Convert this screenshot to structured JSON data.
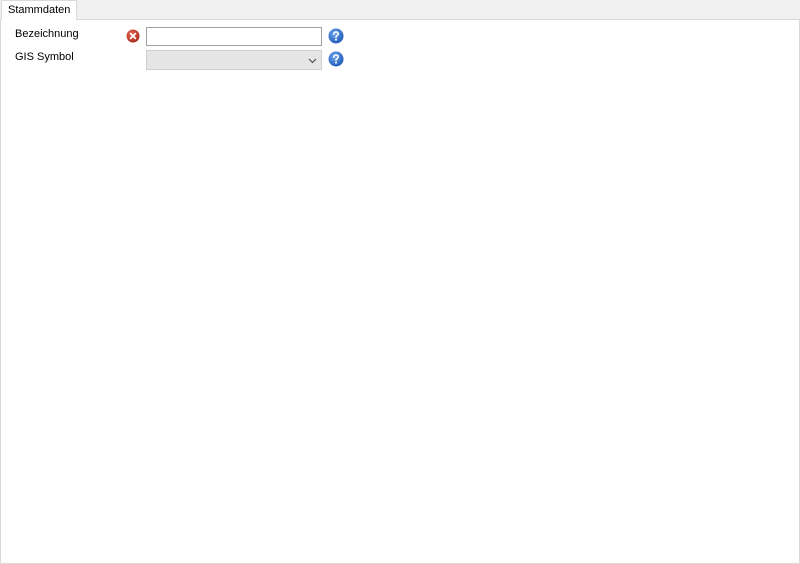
{
  "tabs": [
    {
      "label": "Stammdaten",
      "active": true
    }
  ],
  "form": {
    "bezeichnung": {
      "label": "Bezeichnung",
      "value": "",
      "placeholder": "",
      "status_icon": "error-icon"
    },
    "gis_symbol": {
      "label": "GIS Symbol",
      "selected": ""
    }
  },
  "icons": {
    "help": "question-circle-icon",
    "error": "x-circle-icon",
    "dropdown": "chevron-down-icon"
  },
  "colors": {
    "error": "#c0392b",
    "help": "#2f73d4",
    "panel_background": "#ffffff",
    "window_background": "#f0f0f0"
  }
}
